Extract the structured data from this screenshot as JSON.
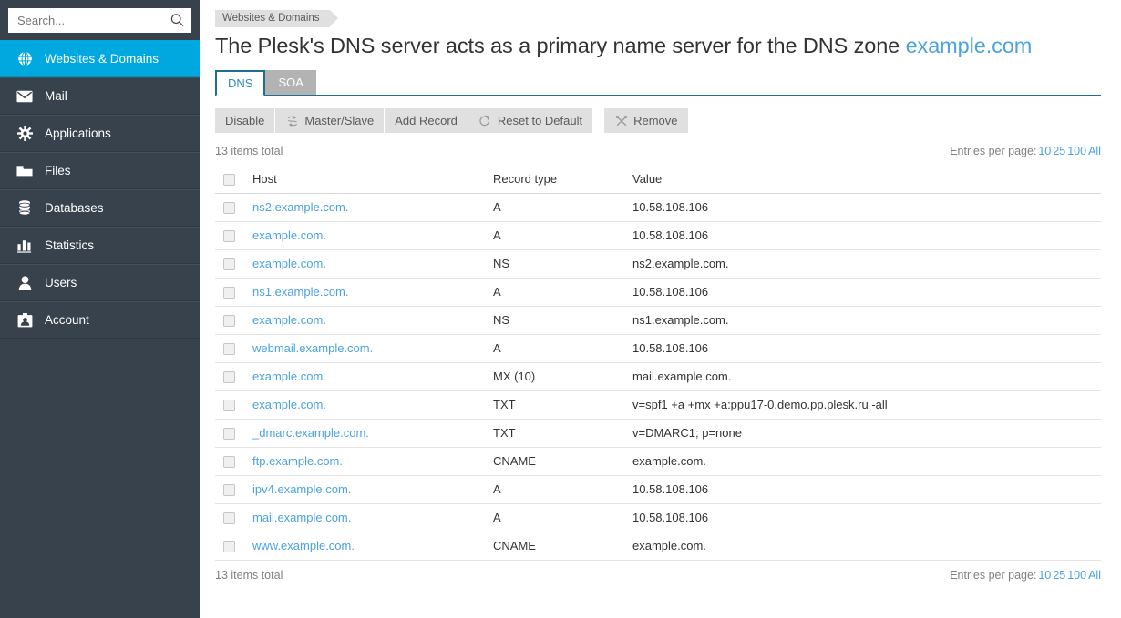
{
  "sidebar": {
    "search": {
      "placeholder": "Search...",
      "value": "",
      "icon": "search-icon"
    },
    "items": [
      {
        "label": "Websites & Domains",
        "icon": "globe-icon",
        "active": true
      },
      {
        "label": "Mail",
        "icon": "envelope-icon",
        "active": false
      },
      {
        "label": "Applications",
        "icon": "gear-icon",
        "active": false
      },
      {
        "label": "Files",
        "icon": "folder-icon",
        "active": false
      },
      {
        "label": "Databases",
        "icon": "database-icon",
        "active": false
      },
      {
        "label": "Statistics",
        "icon": "bar-chart-icon",
        "active": false
      },
      {
        "label": "Users",
        "icon": "user-icon",
        "active": false
      },
      {
        "label": "Account",
        "icon": "id-card-icon",
        "active": false
      }
    ]
  },
  "breadcrumb": {
    "label": "Websites & Domains"
  },
  "header": {
    "title_text": "The Plesk's DNS server acts as a primary name server for the DNS zone ",
    "title_link": "example.com"
  },
  "tabs": [
    {
      "label": "DNS",
      "active": true
    },
    {
      "label": "SOA",
      "active": false
    }
  ],
  "toolbar": [
    {
      "label": "Disable",
      "icon": "none"
    },
    {
      "label": "Master/Slave",
      "icon": "swap-arrows-icon"
    },
    {
      "label": "Add Record",
      "icon": "none"
    },
    {
      "label": "Reset to Default",
      "icon": "refresh-icon"
    },
    {
      "label": "Remove",
      "icon": "cross-icon"
    }
  ],
  "list": {
    "items_total_top": "13 items total",
    "items_total_bottom": "13 items total",
    "entries_label": "Entries per page:",
    "entries_options": [
      "10",
      "25",
      "100",
      "All"
    ],
    "columns": [
      "Host",
      "Record type",
      "Value"
    ],
    "rows": [
      {
        "host": "ns2.example.com.",
        "type": "A",
        "value": "10.58.108.106"
      },
      {
        "host": "example.com.",
        "type": "A",
        "value": "10.58.108.106"
      },
      {
        "host": "example.com.",
        "type": "NS",
        "value": "ns2.example.com."
      },
      {
        "host": "ns1.example.com.",
        "type": "A",
        "value": "10.58.108.106"
      },
      {
        "host": "example.com.",
        "type": "NS",
        "value": "ns1.example.com."
      },
      {
        "host": "webmail.example.com.",
        "type": "A",
        "value": "10.58.108.106"
      },
      {
        "host": "example.com.",
        "type": "MX (10)",
        "value": "mail.example.com."
      },
      {
        "host": "example.com.",
        "type": "TXT",
        "value": "v=spf1 +a +mx +a:ppu17-0.demo.pp.plesk.ru -all"
      },
      {
        "host": "_dmarc.example.com.",
        "type": "TXT",
        "value": "v=DMARC1; p=none"
      },
      {
        "host": "ftp.example.com.",
        "type": "CNAME",
        "value": "example.com."
      },
      {
        "host": "ipv4.example.com.",
        "type": "A",
        "value": "10.58.108.106"
      },
      {
        "host": "mail.example.com.",
        "type": "A",
        "value": "10.58.108.106"
      },
      {
        "host": "www.example.com.",
        "type": "CNAME",
        "value": "example.com."
      }
    ]
  },
  "colors": {
    "sidebar_bg": "#37424d",
    "accent": "#00a8e0",
    "link": "#4aa3df",
    "tab_border": "#1f6f94",
    "button_bg": "#e0e0e0"
  }
}
